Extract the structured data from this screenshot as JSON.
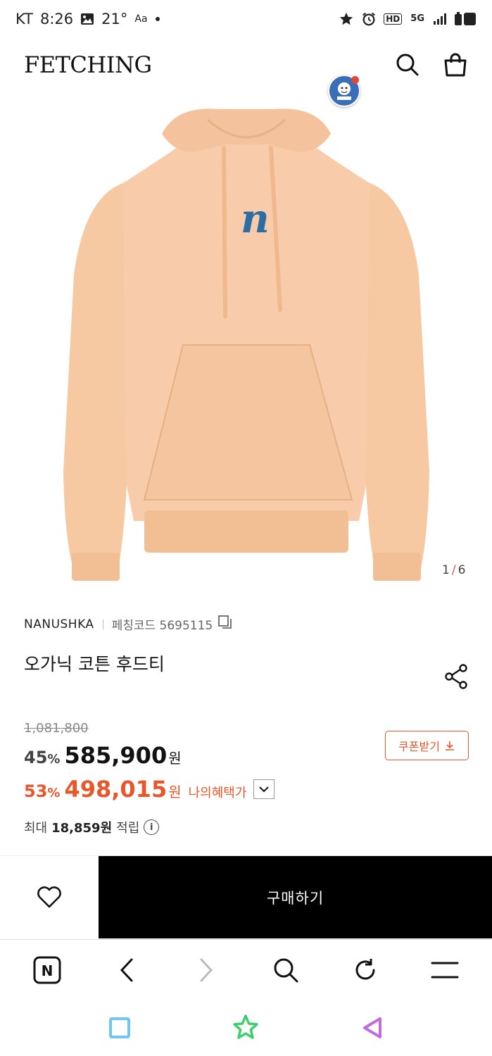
{
  "status_bar": {
    "carrier": "KT",
    "time": "8:26",
    "temperature": "21°",
    "network": "5G",
    "hd": "HD",
    "battery": "1"
  },
  "header": {
    "logo": "FETCHING",
    "icons": [
      "search-icon",
      "shopping-bag-icon"
    ]
  },
  "product": {
    "image_counter": {
      "current": "1",
      "separator": "/",
      "total": "6"
    },
    "brand": "NANUSHKA",
    "code_label": "페칭코드 5695115",
    "name": "오가닉 코튼 후드티",
    "original_price": "1,081,800",
    "discount1_value": "45",
    "discount1_pct": "%",
    "price1": "585,900",
    "won": "원",
    "discount2_value": "53",
    "discount2_pct": "%",
    "price2": "498,015",
    "benefit_label": "나의혜택가",
    "coupon_label": "쿠폰받기",
    "points_prefix": "최대",
    "points_value": "18,859원",
    "points_suffix": "적립"
  },
  "actions": {
    "buy_label": "구매하기"
  },
  "colors": {
    "accent": "#e8562a",
    "hoodie": "#f6c9a2",
    "logo_blue": "#2e6da4",
    "buy_bg": "#000000"
  }
}
